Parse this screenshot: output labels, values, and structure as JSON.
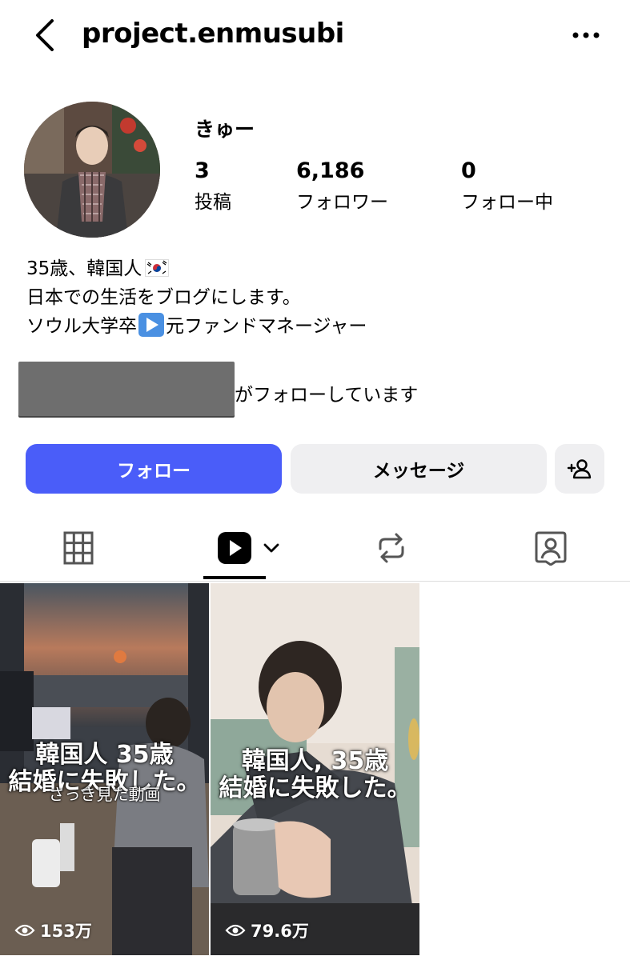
{
  "header": {
    "username": "project.enmusubi"
  },
  "profile": {
    "display_name": "きゅー",
    "stats": [
      {
        "value": "3",
        "label": "投稿"
      },
      {
        "value": "6,186",
        "label": "フォロワー"
      },
      {
        "value": "0",
        "label": "フォロー中"
      }
    ],
    "bio": {
      "line1": "35歳、韓国人",
      "line2": "日本での生活をブログにします。",
      "line3_a": "ソウル大学卒",
      "line3_b": "元ファンドマネージャー"
    },
    "followed_by_text": "がフォローしています"
  },
  "actions": {
    "follow_label": "フォロー",
    "message_label": "メッセージ"
  },
  "tabs": [
    {
      "icon": "grid-icon"
    },
    {
      "icon": "reels-icon",
      "selected": true
    },
    {
      "icon": "reposts-icon"
    },
    {
      "icon": "tagged-icon"
    }
  ],
  "posts": [
    {
      "caption_line1": "韓国人 35歳",
      "caption_line2": "結婚に失敗した。",
      "overlay": "さっき見た動画",
      "views": "153万"
    },
    {
      "caption_line1": "韓国人, 35歳",
      "caption_line2": "結婚に失敗した。",
      "views": "79.6万"
    }
  ],
  "colors": {
    "follow_button": "#4a5df9",
    "secondary_button": "#efeff1"
  }
}
